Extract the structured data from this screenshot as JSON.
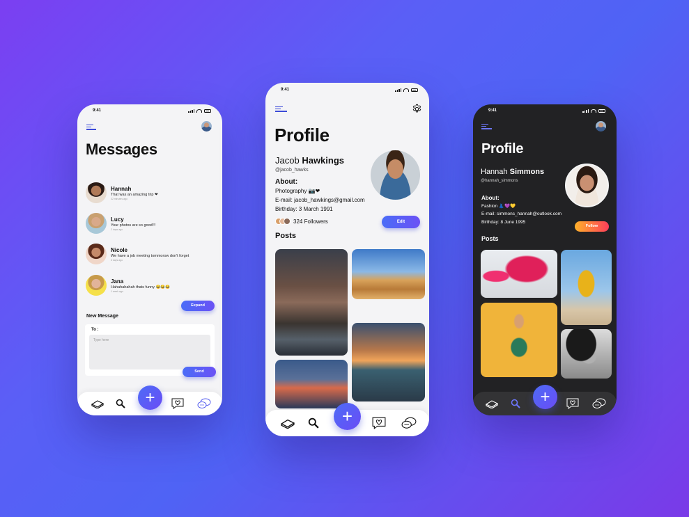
{
  "status": {
    "time": "9:41"
  },
  "messages_screen": {
    "title": "Messages",
    "items": [
      {
        "name": "Hannah",
        "text": "That was an amazing trip ❤",
        "time": "32 minutes ago"
      },
      {
        "name": "Lucy",
        "text": "Your photos are so good!!!",
        "time": "2 days ago"
      },
      {
        "name": "Nicole",
        "text": "We have a job meeting tommorow don't forget",
        "time": "3 days ago"
      },
      {
        "name": "Jana",
        "text": "Hahahahahah thats funny 😂😂😂",
        "time": "1 week ago"
      }
    ],
    "expand_label": "Expand",
    "new_message_label": "New Message",
    "to_label": "To :",
    "input_placeholder": "Type here",
    "send_label": "Send"
  },
  "profile_screen": {
    "title": "Profile",
    "first_name": "Jacob",
    "last_name": "Hawkings",
    "handle": "@jacob_hawks",
    "about_label": "About:",
    "about_interest": "Photography 📷❤",
    "about_email": "E-mail: jacob_hawkings@gmail.com",
    "about_birthday": "Birthday: 3 March 1991",
    "followers": "324 Followers",
    "edit_label": "Edit",
    "posts_label": "Posts"
  },
  "profile_dark_screen": {
    "title": "Profile",
    "first_name": "Hannah",
    "last_name": "Simmons",
    "handle": "@hannah_simmons",
    "about_label": "About:",
    "about_interest": "Fashion 👗💜💛",
    "about_email": "E-mail: simmons_hannah@outlook.com",
    "about_birthday": "Birthday: 8 June 1995",
    "follow_label": "Follow",
    "posts_label": "Posts"
  },
  "icons": [
    "menu-icon",
    "settings-icon",
    "book-icon",
    "search-icon",
    "plus-icon",
    "heart-chat-icon",
    "chat-bubbles-icon"
  ],
  "colors": {
    "accent": "#4f63f5",
    "dark_bg": "#222224",
    "follow_start": "#ffb12a",
    "follow_end": "#ff3e5a"
  }
}
